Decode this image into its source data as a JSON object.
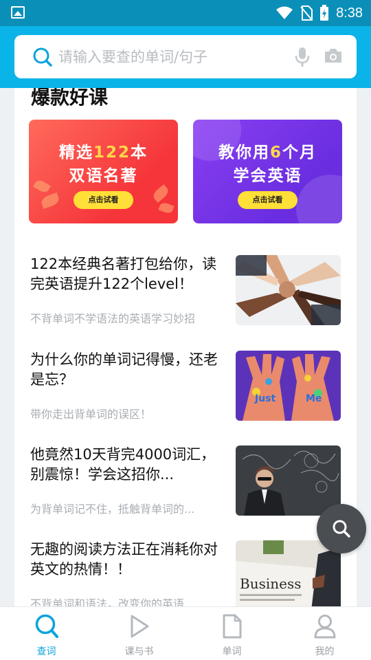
{
  "status_bar": {
    "time": "8:38"
  },
  "search": {
    "placeholder": "请输入要查的单词/句子"
  },
  "section": {
    "title": "爆款好课"
  },
  "courses": [
    {
      "line1_pre": "精选",
      "line1_hl": "122",
      "line1_post": "本",
      "line2": "双语名著",
      "button": "点击试看",
      "color": "#f5353a"
    },
    {
      "line1_pre": "教你用",
      "line1_hl": "6",
      "line1_post": "个月",
      "line2": "学会英语",
      "button": "点击试看",
      "color": "#6a2ee0"
    }
  ],
  "articles": [
    {
      "title": "122本经典名著打包给你，读完英语提升122个level！",
      "subtitle": "不背单词不学语法的英语学习妙招"
    },
    {
      "title": "为什么你的单词记得慢，还老是忘？",
      "subtitle": "带你走出背单词的误区！"
    },
    {
      "title": "他竟然10天背完4000词汇，别震惊！学会这招你...",
      "subtitle": "为背单词记不住，抵触背单词的..."
    },
    {
      "title": "无趣的阅读方法正在消耗你对英文的热情！！",
      "subtitle": "不背单词和语法，改变你的英语..."
    }
  ],
  "thumb_texts": {
    "hands_a": "Just",
    "hands_b": "Me",
    "newspaper": "Business"
  },
  "nav": [
    {
      "label": "查词",
      "icon": "search-icon",
      "active": true
    },
    {
      "label": "课与书",
      "icon": "play-icon",
      "active": false
    },
    {
      "label": "单词",
      "icon": "document-icon",
      "active": false
    },
    {
      "label": "我的",
      "icon": "user-icon",
      "active": false
    }
  ],
  "colors": {
    "header": "#0ab3e8",
    "status_bar": "#0a8fb8",
    "accent": "#0aa3dd"
  }
}
